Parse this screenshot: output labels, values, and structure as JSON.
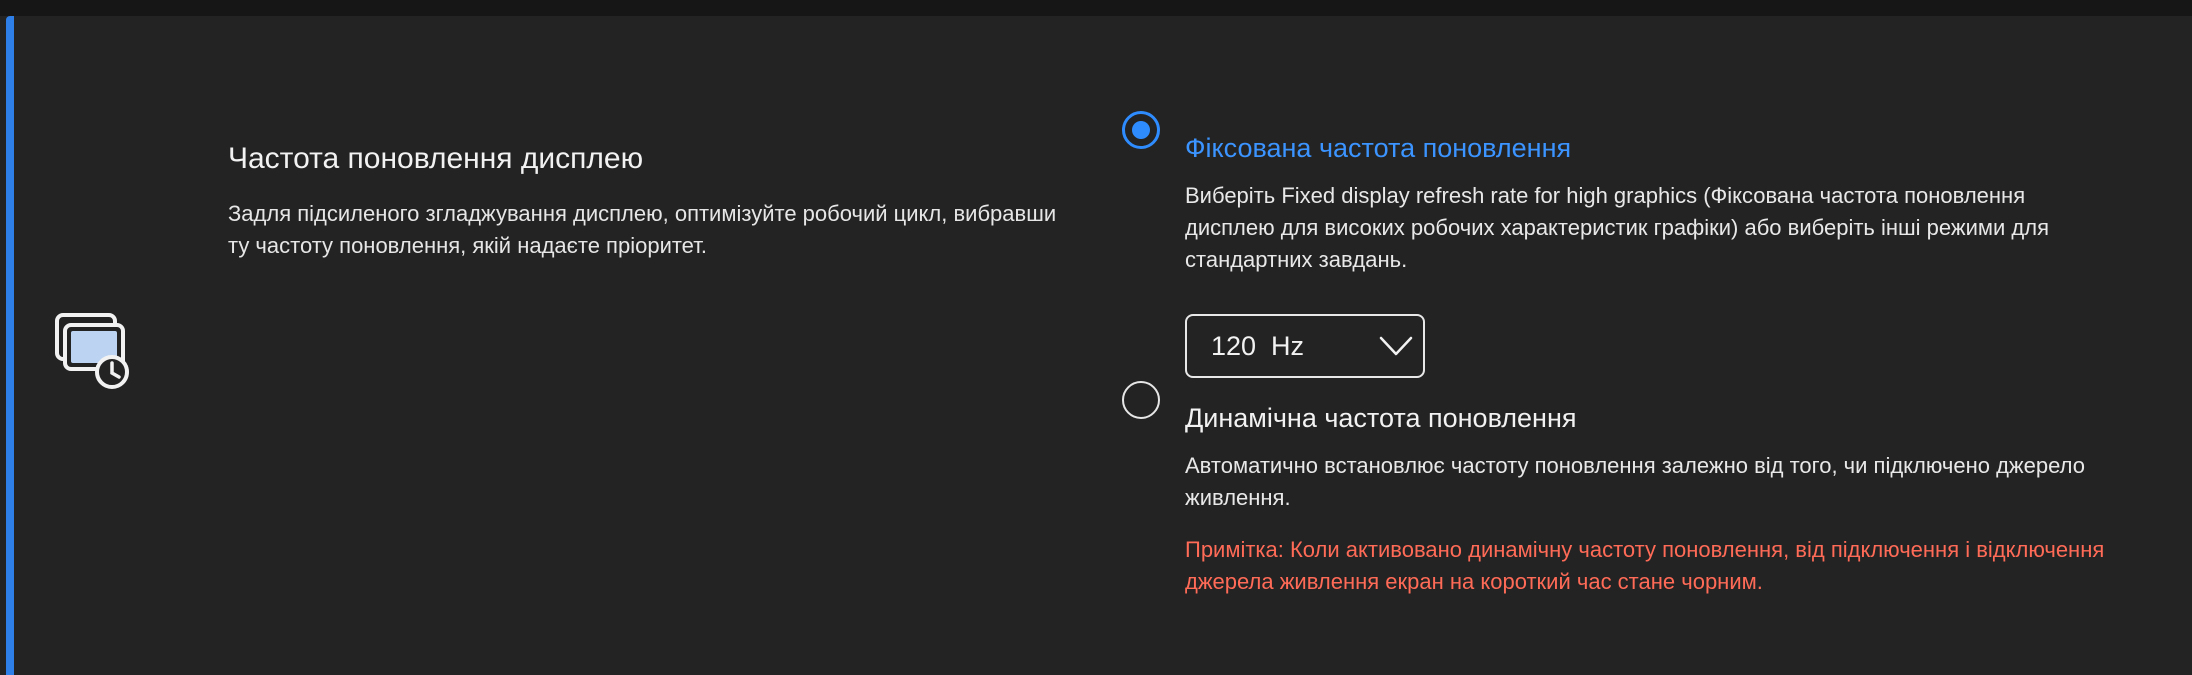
{
  "section": {
    "title": "Частота поновлення дисплею",
    "description": "Задля підсиленого згладжування дисплею, оптимізуйте робочий цикл, вибравши ту частоту поновлення, якій надаєте пріоритет.",
    "icon": "display-refresh-clock-icon"
  },
  "options": {
    "fixed": {
      "label": "Фіксована частота поновлення",
      "description": "Виберіть Fixed display refresh rate for high graphics (Фіксована частота поновлення дисплею для високих робочих характеристик графіки) або виберіть інші режими для стандартних завдань.",
      "selected": true,
      "dropdown": {
        "value": "120  Hz"
      }
    },
    "dynamic": {
      "label": "Динамічна частота поновлення",
      "description": "Автоматично встановлює частоту поновлення залежно від того, чи підключено джерело живлення.",
      "selected": false,
      "note": "Примітка: Коли активовано динамічну частоту поновлення, від підключення і відключення джерела живлення екран на короткий час стане чорним."
    }
  },
  "colors": {
    "accent": "#2f8cff",
    "note": "#ff6b57",
    "background": "#232323"
  }
}
